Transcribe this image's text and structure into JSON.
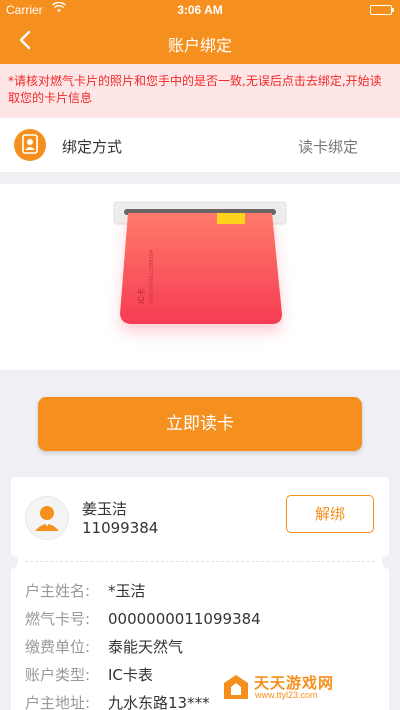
{
  "status_bar": {
    "carrier": "Carrier",
    "time": "3:06 AM",
    "battery_level": 1.0
  },
  "nav": {
    "title": "账户绑定",
    "back_icon": "chevron-left-icon"
  },
  "notice": {
    "text": "*请核对燃气卡片的照片和您手中的是否一致,无误后点击去绑定,开始读取您的卡片信息"
  },
  "bind_method": {
    "label": "绑定方式",
    "value": "读卡绑定",
    "icon": "user-circle-icon"
  },
  "card_illustration": {
    "card_text": "IC卡",
    "colors": {
      "card_start": "#ff7a6a",
      "card_end": "#f53c53",
      "chip": "#ffd21e"
    }
  },
  "read_button": {
    "label": "立即读卡"
  },
  "account": {
    "name": "姜玉洁",
    "number": "11099384",
    "unbind_label": "解绑",
    "fields": [
      {
        "key": "户主姓名:",
        "value": "*玉洁"
      },
      {
        "key": "燃气卡号:",
        "value": "0000000011099384"
      },
      {
        "key": "缴费单位:",
        "value": "泰能天然气"
      },
      {
        "key": "账户类型:",
        "value": "IC卡表"
      },
      {
        "key": "户主地址:",
        "value": "九水东路13***"
      }
    ]
  },
  "watermark": {
    "title": "天天游戏网",
    "url": "www.ttyl23.com"
  },
  "colors": {
    "accent": "#f5901e",
    "notice_text": "#ee2a2a",
    "notice_bg": "#ffe6e6"
  }
}
